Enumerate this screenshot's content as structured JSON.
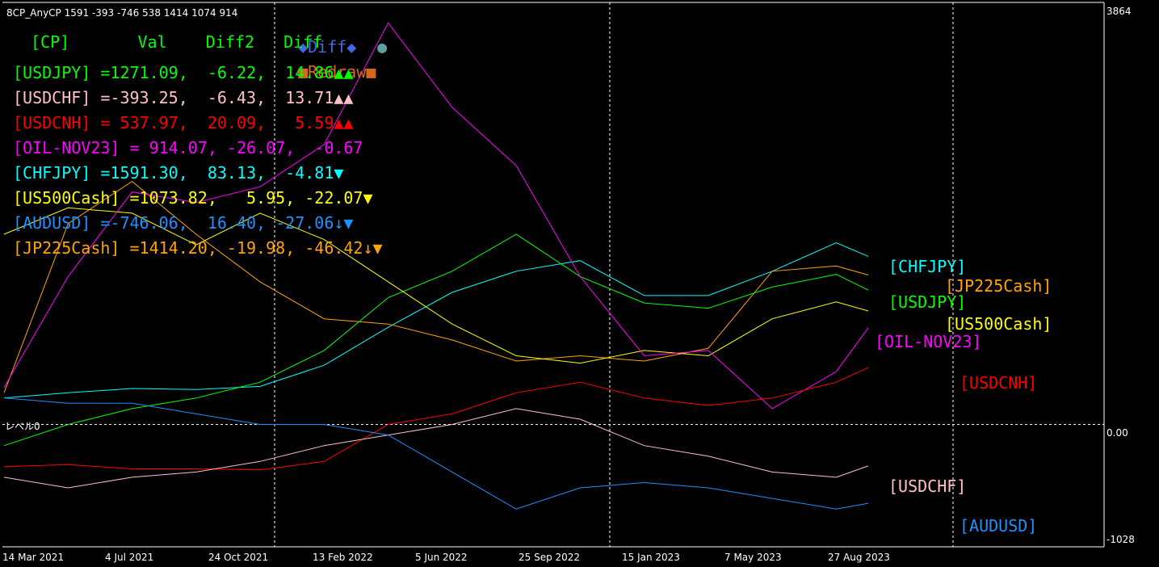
{
  "window": {
    "title": "8CP_AnyCP 1591 -393 -746 538 1414 1074 914"
  },
  "buttons": {
    "diff_label": "◆Diff◆",
    "circle_label": "●",
    "redraw_label": "■Redraw■"
  },
  "hud": {
    "header": "[CP]       Val    Diff2   Diff",
    "rows": [
      {
        "text": "[USDJPY] =1271.09,  -6.22,  14.86▲▲",
        "color": "#00ff00"
      },
      {
        "text": "[USDCHF] =-393.25,  -6.43,  13.71▲▲",
        "color": "#ffc0cb"
      },
      {
        "text": "[USDCNH] = 537.97,  20.09,   5.59▲▲",
        "color": "#ff0000"
      },
      {
        "text": "[OIL-NOV23] = 914.07, -26.07,  -0.67",
        "color": "#ff00ff"
      },
      {
        "text": "[CHFJPY] =1591.30,  83.13,  -4.81▼",
        "color": "#00ffff"
      },
      {
        "text": "[US500Cash] =1073.82,   5.95, -22.07▼",
        "color": "#ffff00"
      },
      {
        "text": "[AUDUSD] =-746.06,  16.40, -27.06↓▼",
        "color": "#1e90ff"
      },
      {
        "text": "[JP225Cash] =1414.20, -19.98, -46.42↓▼",
        "color": "#ffa500"
      }
    ]
  },
  "colors": {
    "background": "#000000",
    "header_green": "#00ff00",
    "diff_blue": "#4169e1",
    "circle_teal": "#5f9ea0",
    "redraw_orange": "#d2691e",
    "grid": "#ffffff"
  },
  "chart_data": {
    "type": "line",
    "ylim": [
      -1028,
      3864
    ],
    "y_ticks": [
      "3864",
      "-1028"
    ],
    "zero_label": "0.00",
    "level_label": "レベル0",
    "x_ticks": [
      "14 Mar 2021",
      "4 Jul 2021",
      "24 Oct 2021",
      "13 Feb 2022",
      "5 Jun 2022",
      "25 Sep 2022",
      "15 Jan 2023",
      "7 May 2023",
      "27 Aug 2023"
    ],
    "x": [
      "2021-03-14",
      "2021-05-23",
      "2021-08-01",
      "2021-10-10",
      "2021-12-19",
      "2022-02-27",
      "2022-05-08",
      "2022-07-17",
      "2022-09-25",
      "2022-12-04",
      "2023-02-12",
      "2023-04-23",
      "2023-07-02",
      "2023-09-10",
      "2023-10-15"
    ],
    "series": [
      {
        "name": "CHFJPY",
        "color": "#00ffff",
        "values": [
          250,
          300,
          340,
          330,
          360,
          560,
          920,
          1250,
          1450,
          1550,
          1220,
          1220,
          1450,
          1720,
          1591
        ]
      },
      {
        "name": "JP225Cash",
        "color": "#ffa500",
        "values": [
          300,
          1900,
          2300,
          1800,
          1350,
          1000,
          950,
          800,
          600,
          650,
          600,
          720,
          1450,
          1500,
          1414
        ]
      },
      {
        "name": "USDJPY",
        "color": "#00ff00",
        "values": [
          -200,
          0,
          150,
          250,
          400,
          700,
          1200,
          1450,
          1800,
          1400,
          1150,
          1100,
          1300,
          1420,
          1271
        ]
      },
      {
        "name": "US500Cash",
        "color": "#ffff00",
        "values": [
          1800,
          2050,
          2000,
          1700,
          2000,
          1750,
          1350,
          950,
          650,
          580,
          700,
          650,
          1000,
          1160,
          1074
        ]
      },
      {
        "name": "OIL-NOV23",
        "color": "#ff00ff",
        "values": [
          350,
          1400,
          2200,
          2100,
          2250,
          2650,
          3800,
          3000,
          2450,
          1400,
          650,
          700,
          150,
          500,
          914
        ]
      },
      {
        "name": "USDCNH",
        "color": "#ff0000",
        "values": [
          -400,
          -380,
          -420,
          -420,
          -430,
          -350,
          0,
          100,
          300,
          400,
          250,
          180,
          250,
          400,
          538
        ]
      },
      {
        "name": "USDCHF",
        "color": "#ffc0cb",
        "values": [
          -500,
          -600,
          -500,
          -450,
          -350,
          -200,
          -100,
          0,
          150,
          50,
          -200,
          -300,
          -450,
          -500,
          -393
        ]
      },
      {
        "name": "AUDUSD",
        "color": "#1e90ff",
        "values": [
          250,
          200,
          200,
          100,
          0,
          0,
          -100,
          -450,
          -800,
          -600,
          -550,
          -600,
          -700,
          -800,
          -746
        ]
      }
    ],
    "label_positions_hint": "right-side",
    "grid": true
  }
}
